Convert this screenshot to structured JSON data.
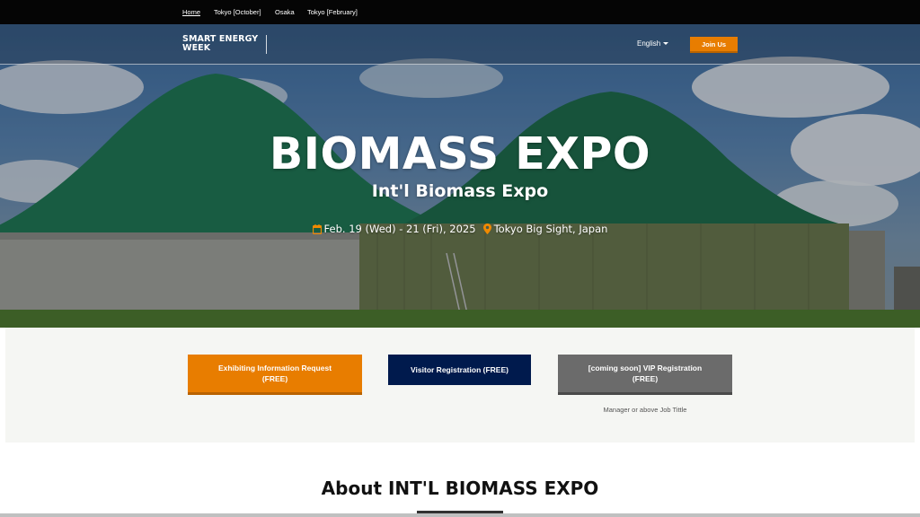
{
  "topnav": {
    "items": [
      "Home",
      "Tokyo [October]",
      "Osaka",
      "Tokyo [February]"
    ]
  },
  "header": {
    "logo_line1": "SMART ENERGY",
    "logo_line2": "WEEK",
    "language": "English",
    "join_label": "Join Us"
  },
  "hero": {
    "title": "BIOMASS EXPO",
    "subtitle": "Int'l Biomass Expo",
    "dates": "Feb. 19 (Wed) - 21 (Fri), 2025",
    "venue": "Tokyo Big Sight, Japan",
    "icons": [
      "calendar-icon",
      "location-pin-icon"
    ]
  },
  "registration": {
    "exhibit_line1": "Exhibiting Information Request",
    "exhibit_line2": "(FREE)",
    "visitor_label": "Visitor Registration (FREE)",
    "vip_line1": "[coming soon] VIP Registration",
    "vip_line2": "(FREE)",
    "vip_note": "Manager or above Job Tittle"
  },
  "about": {
    "heading": "About INT'L BIOMASS EXPO"
  },
  "colors": {
    "accent_orange": "#e87d00",
    "navy": "#001a4d",
    "grey_button": "#6b6b6b",
    "topnav_bg": "#050505"
  }
}
